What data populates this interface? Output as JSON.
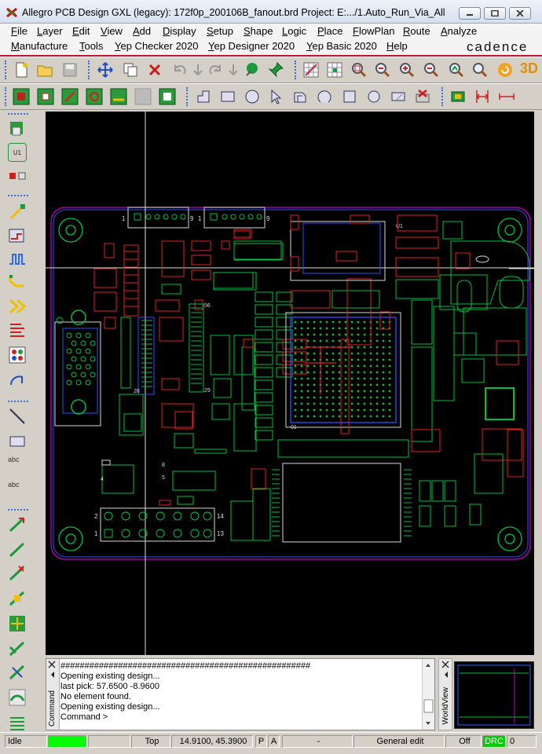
{
  "window": {
    "title": "Allegro PCB Design GXL (legacy): 172f0p_200106B_fanout.brd  Project: E:.../1.Auto_Run_Via_All",
    "controls": [
      "minimize",
      "maximize",
      "close"
    ]
  },
  "menu": {
    "row1": [
      "File",
      "Layer",
      "Edit",
      "View",
      "Add",
      "Display",
      "Setup",
      "Shape",
      "Logic",
      "Place",
      "FlowPlan",
      "Route",
      "Analyze"
    ],
    "row2": [
      "Manufacture",
      "Tools",
      "Yep Checker 2020",
      "Yep Designer 2020",
      "Yep Basic 2020",
      "Help"
    ],
    "brand": "cadence"
  },
  "toolbar1": {
    "icons": [
      "new-file-icon",
      "open-folder-icon",
      "save-icon",
      "move-icon",
      "copy-icon",
      "delete-icon",
      "undo-icon",
      "undo-down-icon",
      "redo-icon",
      "redo-down-icon",
      "ratsnest-icon",
      "pin-icon",
      "grid-icon",
      "grid-snap-icon",
      "zoom-fit-icon",
      "zoom-window-icon",
      "zoom-in-icon",
      "zoom-out-icon",
      "zoom-previous-icon",
      "zoom-world-icon",
      "refresh-icon",
      "3d-view-icon"
    ],
    "label_3d": "3D"
  },
  "toolbar2": {
    "icons": [
      "place-comp-1-icon",
      "place-comp-2-icon",
      "place-comp-3-icon",
      "place-comp-4-icon",
      "place-comp-5-icon",
      "place-comp-6-icon",
      "place-comp-7-icon",
      "shape-1-icon",
      "shape-rect-icon",
      "shape-circle-icon",
      "select-icon",
      "shape-poly-icon",
      "shape-arc-icon",
      "shape-square-icon",
      "shape-circle-2-icon",
      "shape-erase-icon",
      "delete-shape-icon",
      "module-icon",
      "dimension-icon",
      "measure-icon"
    ]
  },
  "left_toolbar": {
    "icons": [
      "place-manual-icon",
      "place-u1-icon",
      "place-swap-icon",
      "add-connect-icon",
      "slide-icon",
      "delay-tune-icon",
      "custom-smooth-icon",
      "fanout-icon",
      "spread-icon",
      "fanout-by-pick-icon",
      "auto-route-icon",
      "add-line-icon",
      "add-rect-icon",
      "add-text-icon",
      "edit-text-icon",
      "route-1-icon",
      "route-2-icon",
      "route-3-icon",
      "route-4-icon",
      "route-5-icon",
      "route-6-icon",
      "route-7-icon",
      "route-8-icon",
      "route-9-icon"
    ],
    "text_labels": [
      "U1",
      "abc",
      "abc"
    ]
  },
  "board": {
    "connector_labels": [
      "1",
      "9",
      "1",
      "9"
    ],
    "pin_labels": [
      "28",
      "56",
      "29",
      "8",
      "5",
      "4",
      "2",
      "14",
      "1",
      "13",
      "01",
      "U1"
    ]
  },
  "command": {
    "tab_label": "Command",
    "lines": [
      "####################################################",
      "Opening existing design...",
      "last pick:  57.6500 -8.9600",
      "No element found.",
      "Opening existing design...",
      "Command >"
    ]
  },
  "worldview": {
    "tab_label": "WorldView"
  },
  "status": {
    "state": "Idle",
    "layer": "Top",
    "coords": "14.9100, 45.3900",
    "p_btn": "P",
    "a_btn": "A",
    "dash": "-",
    "mode": "General edit",
    "off": "Off",
    "drc": "DRC",
    "drc_count": "0"
  },
  "colors": {
    "accent_red": "#c8102e",
    "drc_green": "#00d000",
    "status_green": "#00ff00",
    "canvas_bg": "#000000",
    "board_outline": "#c000c0",
    "pad_green": "#00c040",
    "pad_red": "#e02020",
    "silk_white": "#d8d8d8",
    "body_blue": "#3050ff"
  }
}
